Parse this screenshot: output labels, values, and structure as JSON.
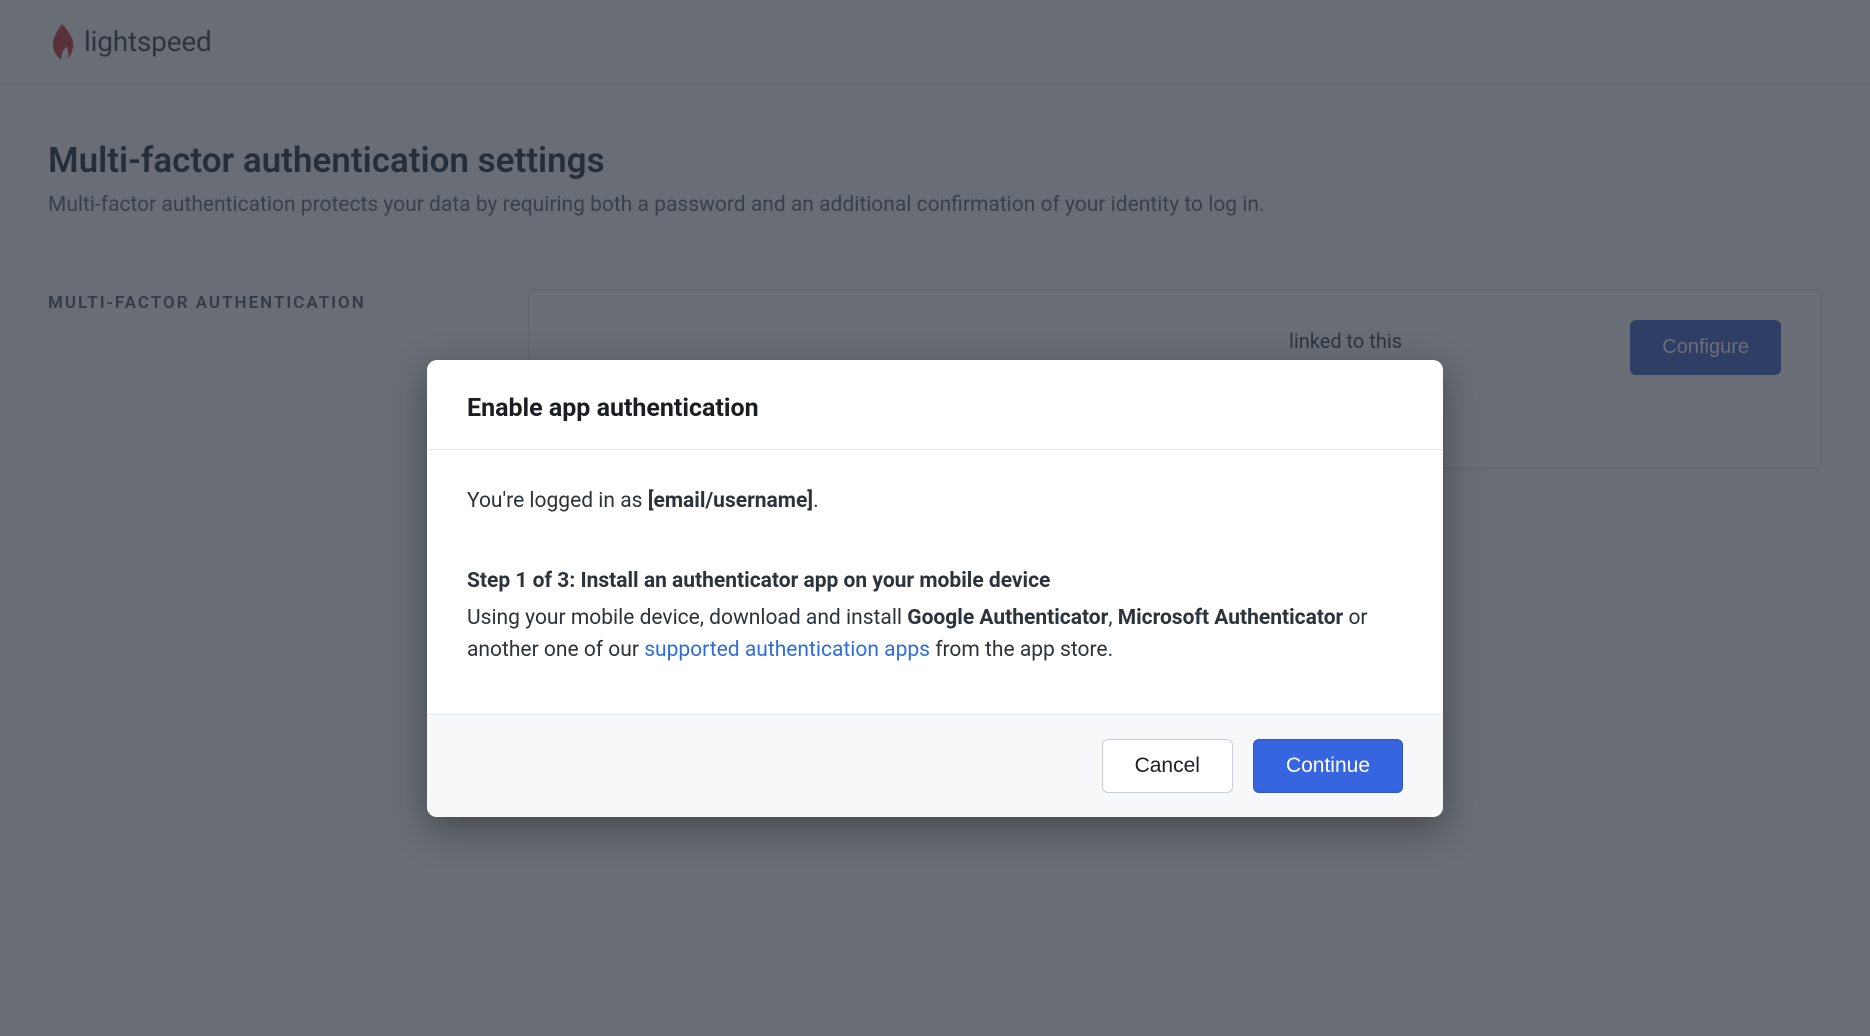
{
  "brand": {
    "name": "lightspeed"
  },
  "page": {
    "title": "Multi-factor authentication settings",
    "description": "Multi-factor authentication protects your data by requiring both a password and an additional confirmation of your identity to log in."
  },
  "section": {
    "label": "MULTI-FACTOR AUTHENTICATION",
    "card_text_suffix": "linked to this",
    "configure_label": "Configure"
  },
  "modal": {
    "title": "Enable app authentication",
    "login_prefix": "You're logged in as ",
    "login_user": "[email/username]",
    "login_suffix": ".",
    "step_heading": "Step 1 of 3: Install an authenticator app on your mobile device",
    "step_text_1": "Using your mobile device, download and install ",
    "app1": "Google Authenticator",
    "comma": ", ",
    "app2": "Microsoft Authenticator",
    "step_text_2": " or another one of our ",
    "link_text": "supported authentication apps",
    "step_text_3": " from the app store.",
    "cancel_label": "Cancel",
    "continue_label": "Continue"
  }
}
